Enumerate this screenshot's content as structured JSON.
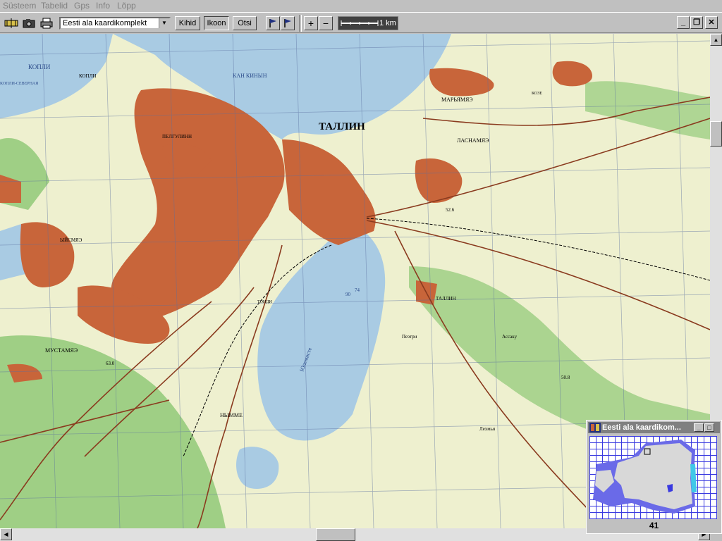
{
  "menu": [
    {
      "label": "Süsteem"
    },
    {
      "label": "Tabelid"
    },
    {
      "label": "Gps"
    },
    {
      "label": "Info"
    },
    {
      "label": "Lõpp"
    }
  ],
  "toolbar": {
    "map_set_select": "Eesti ala kaardikomplekt",
    "layers_label": "Kihid",
    "icon_label": "Ikoon",
    "search_label": "Otsi",
    "zoom_in_label": "+",
    "zoom_out_label": "−",
    "scale_label": "1 km"
  },
  "map": {
    "city_label": "ТАЛЛИН",
    "labels": {
      "kopli": "КОПЛИ",
      "kopli_bay": "КОПЛИ",
      "kalamaja": "КАН КИНЫН",
      "pelgulinn": "ПЕЛГУЛИНН",
      "marjamae": "МАРЬЯМЯЭ",
      "lasnamae": "ЛАСНАМЯЭ",
      "joe": "ЫЙСМЯЭ",
      "mustamae": "МУСТАМЯЭ",
      "nomme": "НЫММЕ",
      "tallinn_south": "ТАЛЛИН",
      "peetri": "Пеэтри",
      "assaku": "Ассаку",
      "lehmja": "Лехмья",
      "kopli_ridge": "КОПЛИ-СЕВЕРНАЯ",
      "lake_label": "Юлемисте",
      "kose": "КОЗЕ",
      "tondi": "ТОНДИ",
      "height_1": "52.6",
      "height_2": "63.0",
      "height_3": "90",
      "height_4": "74",
      "height_5": "50.8"
    }
  },
  "overview": {
    "title": "Eesti ala kaardikom...",
    "sheet_number": "41"
  },
  "colors": {
    "urban": "#c8653a",
    "water": "#a9cbe3",
    "forest": "#9fcf85",
    "paper": "#eef0cf",
    "grid": "#5a6fa0",
    "road": "#8a3b1f"
  }
}
